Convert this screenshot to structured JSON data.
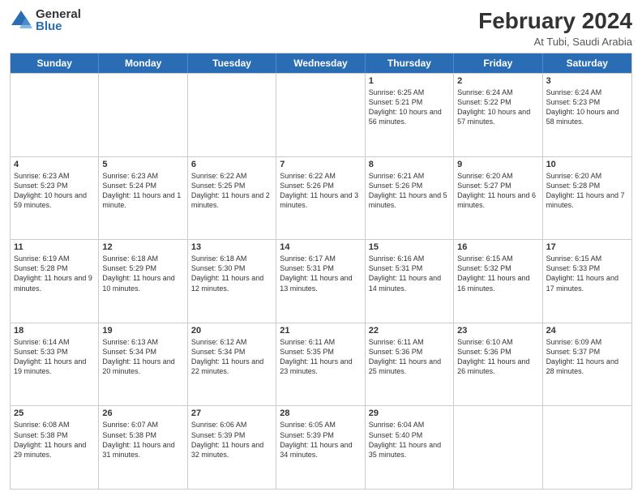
{
  "header": {
    "logo_general": "General",
    "logo_blue": "Blue",
    "month_year": "February 2024",
    "location": "At Tubi, Saudi Arabia"
  },
  "days_of_week": [
    "Sunday",
    "Monday",
    "Tuesday",
    "Wednesday",
    "Thursday",
    "Friday",
    "Saturday"
  ],
  "weeks": [
    [
      {
        "day": "",
        "info": ""
      },
      {
        "day": "",
        "info": ""
      },
      {
        "day": "",
        "info": ""
      },
      {
        "day": "",
        "info": ""
      },
      {
        "day": "1",
        "info": "Sunrise: 6:25 AM\nSunset: 5:21 PM\nDaylight: 10 hours and 56 minutes."
      },
      {
        "day": "2",
        "info": "Sunrise: 6:24 AM\nSunset: 5:22 PM\nDaylight: 10 hours and 57 minutes."
      },
      {
        "day": "3",
        "info": "Sunrise: 6:24 AM\nSunset: 5:23 PM\nDaylight: 10 hours and 58 minutes."
      }
    ],
    [
      {
        "day": "4",
        "info": "Sunrise: 6:23 AM\nSunset: 5:23 PM\nDaylight: 10 hours and 59 minutes."
      },
      {
        "day": "5",
        "info": "Sunrise: 6:23 AM\nSunset: 5:24 PM\nDaylight: 11 hours and 1 minute."
      },
      {
        "day": "6",
        "info": "Sunrise: 6:22 AM\nSunset: 5:25 PM\nDaylight: 11 hours and 2 minutes."
      },
      {
        "day": "7",
        "info": "Sunrise: 6:22 AM\nSunset: 5:26 PM\nDaylight: 11 hours and 3 minutes."
      },
      {
        "day": "8",
        "info": "Sunrise: 6:21 AM\nSunset: 5:26 PM\nDaylight: 11 hours and 5 minutes."
      },
      {
        "day": "9",
        "info": "Sunrise: 6:20 AM\nSunset: 5:27 PM\nDaylight: 11 hours and 6 minutes."
      },
      {
        "day": "10",
        "info": "Sunrise: 6:20 AM\nSunset: 5:28 PM\nDaylight: 11 hours and 7 minutes."
      }
    ],
    [
      {
        "day": "11",
        "info": "Sunrise: 6:19 AM\nSunset: 5:28 PM\nDaylight: 11 hours and 9 minutes."
      },
      {
        "day": "12",
        "info": "Sunrise: 6:18 AM\nSunset: 5:29 PM\nDaylight: 11 hours and 10 minutes."
      },
      {
        "day": "13",
        "info": "Sunrise: 6:18 AM\nSunset: 5:30 PM\nDaylight: 11 hours and 12 minutes."
      },
      {
        "day": "14",
        "info": "Sunrise: 6:17 AM\nSunset: 5:31 PM\nDaylight: 11 hours and 13 minutes."
      },
      {
        "day": "15",
        "info": "Sunrise: 6:16 AM\nSunset: 5:31 PM\nDaylight: 11 hours and 14 minutes."
      },
      {
        "day": "16",
        "info": "Sunrise: 6:15 AM\nSunset: 5:32 PM\nDaylight: 11 hours and 16 minutes."
      },
      {
        "day": "17",
        "info": "Sunrise: 6:15 AM\nSunset: 5:33 PM\nDaylight: 11 hours and 17 minutes."
      }
    ],
    [
      {
        "day": "18",
        "info": "Sunrise: 6:14 AM\nSunset: 5:33 PM\nDaylight: 11 hours and 19 minutes."
      },
      {
        "day": "19",
        "info": "Sunrise: 6:13 AM\nSunset: 5:34 PM\nDaylight: 11 hours and 20 minutes."
      },
      {
        "day": "20",
        "info": "Sunrise: 6:12 AM\nSunset: 5:34 PM\nDaylight: 11 hours and 22 minutes."
      },
      {
        "day": "21",
        "info": "Sunrise: 6:11 AM\nSunset: 5:35 PM\nDaylight: 11 hours and 23 minutes."
      },
      {
        "day": "22",
        "info": "Sunrise: 6:11 AM\nSunset: 5:36 PM\nDaylight: 11 hours and 25 minutes."
      },
      {
        "day": "23",
        "info": "Sunrise: 6:10 AM\nSunset: 5:36 PM\nDaylight: 11 hours and 26 minutes."
      },
      {
        "day": "24",
        "info": "Sunrise: 6:09 AM\nSunset: 5:37 PM\nDaylight: 11 hours and 28 minutes."
      }
    ],
    [
      {
        "day": "25",
        "info": "Sunrise: 6:08 AM\nSunset: 5:38 PM\nDaylight: 11 hours and 29 minutes."
      },
      {
        "day": "26",
        "info": "Sunrise: 6:07 AM\nSunset: 5:38 PM\nDaylight: 11 hours and 31 minutes."
      },
      {
        "day": "27",
        "info": "Sunrise: 6:06 AM\nSunset: 5:39 PM\nDaylight: 11 hours and 32 minutes."
      },
      {
        "day": "28",
        "info": "Sunrise: 6:05 AM\nSunset: 5:39 PM\nDaylight: 11 hours and 34 minutes."
      },
      {
        "day": "29",
        "info": "Sunrise: 6:04 AM\nSunset: 5:40 PM\nDaylight: 11 hours and 35 minutes."
      },
      {
        "day": "",
        "info": ""
      },
      {
        "day": "",
        "info": ""
      }
    ]
  ]
}
